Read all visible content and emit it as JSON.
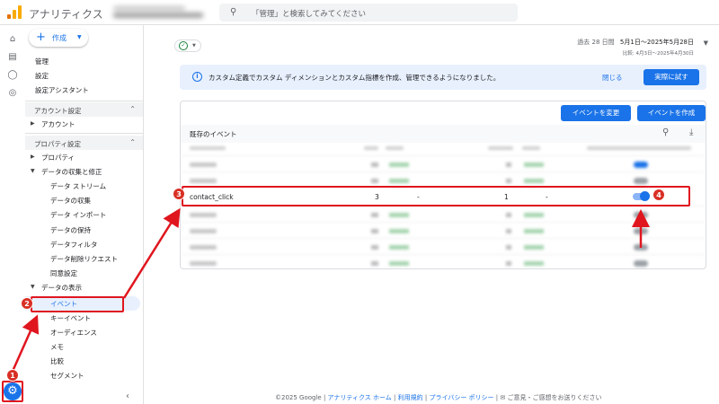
{
  "header": {
    "app_title": "アナリティクス",
    "search_placeholder": "「管理」と検索してみてください"
  },
  "nav": {
    "create_label": "作成",
    "admin_label": "管理",
    "settings_label": "設定",
    "setup_assistant_label": "設定アシスタント",
    "account_settings_section": "アカウント設定",
    "account_label": "アカウント",
    "property_settings_section": "プロパティ設定",
    "property_label": "プロパティ",
    "data_collection_label": "データの収集と修正",
    "data_collection_items": [
      "データ ストリーム",
      "データの収集",
      "データ インポート",
      "データの保持",
      "データフィルタ",
      "データ削除リクエスト",
      "同意設定"
    ],
    "data_display_label": "データの表示",
    "data_display_items": [
      "イベント",
      "キーイベント",
      "オーディエンス",
      "メモ",
      "比較",
      "セグメント"
    ]
  },
  "date_range": {
    "prefix": "過去 28 日間",
    "range": "5月1日～2025年5月28日",
    "compare": "比較: 4月3日～2025年4月30日"
  },
  "banner": {
    "message": "カスタム定義でカスタム ディメンションとカスタム指標を作成、管理できるようになりました。",
    "close_label": "閉じる",
    "try_label": "実際に試す"
  },
  "events_card": {
    "modify_button": "イベントを変更",
    "create_button": "イベントを作成",
    "title": "既存のイベント",
    "highlighted_event": {
      "name": "contact_click",
      "count": "3",
      "count_change": "-",
      "users": "1",
      "users_change": "-",
      "key_event": true
    }
  },
  "footer": {
    "copyright": "©2025 Google |",
    "home_link": "アナリティクス ホーム",
    "sep1": "|",
    "terms_link": "利用規約",
    "sep2": "|",
    "privacy_link": "プライバシー ポリシー",
    "sep3": "|",
    "feedback": "ご意見・ご感想をお送りください"
  },
  "annotations": {
    "step1": "1",
    "step2": "2",
    "step3": "3",
    "step4": "4",
    "color": "#e0161f"
  },
  "colors": {
    "accent": "#1a73e8",
    "logo_orange": "#f9ab00",
    "annotation_red": "#e0161f"
  }
}
